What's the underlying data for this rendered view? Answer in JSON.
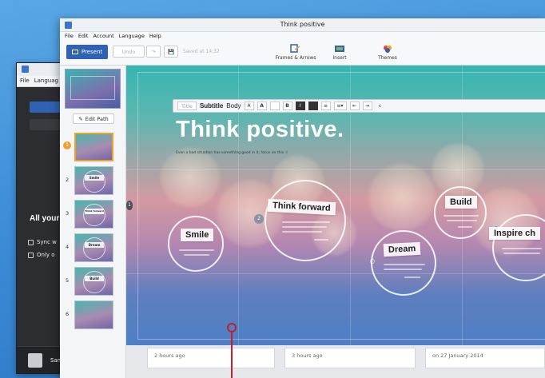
{
  "background_window": {
    "menu": [
      "File",
      "Languag"
    ],
    "heading": "All your",
    "options": [
      "Sync w",
      "Only o"
    ],
    "user_name": "Sam Molinari",
    "user_caret": "▲"
  },
  "window": {
    "title": "Think positive",
    "menu": [
      "File",
      "Edit",
      "Account",
      "Language",
      "Help"
    ]
  },
  "toolbar": {
    "present_label": "Present",
    "undo_label": "Undo",
    "redo_label": "↷",
    "save_label": "💾",
    "saved_text": "Saved at 14:32",
    "frames_label": "Frames & Arrows",
    "insert_label": "Insert",
    "themes_label": "Themes"
  },
  "sidebar": {
    "edit_path_label": "Edit Path",
    "thumbnails": [
      {
        "num": "1",
        "label": "",
        "selected": true
      },
      {
        "num": "2",
        "label": "Smile",
        "selected": false
      },
      {
        "num": "3",
        "label": "Think forward",
        "selected": false
      },
      {
        "num": "4",
        "label": "Dream",
        "selected": false
      },
      {
        "num": "5",
        "label": "Build",
        "selected": false
      },
      {
        "num": "6",
        "label": "",
        "selected": false
      }
    ]
  },
  "format_bar": {
    "title_btn": "Title",
    "subtitle_btn": "Subtitle",
    "body_btn": "Body",
    "font_small": "A",
    "font_large": "A",
    "bold": "B",
    "italic": "I",
    "back_arrow": "‹"
  },
  "canvas": {
    "title": "Think positive.",
    "subtitle": "Even a bad situation has something good in it, focus on this :)",
    "topics": {
      "smile": "Smile",
      "think_forward": "Think forward",
      "dream": "Dream",
      "build": "Build",
      "inspire": "Inspire ch"
    },
    "path_markers": {
      "first": "1",
      "second": "2"
    }
  },
  "bottom_cards": [
    "2 hours ago",
    "3 hours ago",
    "on 27 January 2014"
  ]
}
